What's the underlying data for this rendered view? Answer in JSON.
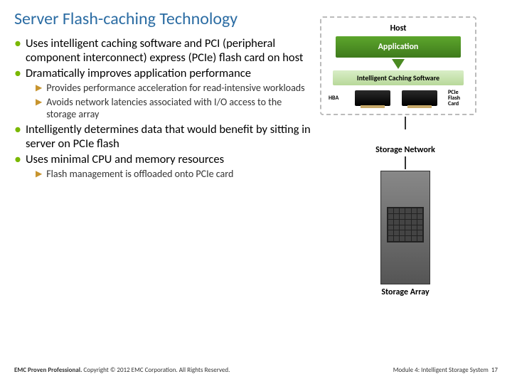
{
  "title": "Server Flash-caching Technology",
  "bullets": {
    "b1": "Uses intelligent caching software and PCI (peripheral component interconnect) express (PCIe) flash card on host",
    "b2": "Dramatically improves application performance",
    "s1": "Provides performance acceleration for read-intensive workloads",
    "s2": "Avoids network latencies associated with I/O access to the storage array",
    "b3": "Intelligently determines data that would benefit by sitting in server on PCIe flash",
    "b4": "Uses minimal CPU and memory resources",
    "s3": "Flash management is offloaded onto PCIe card"
  },
  "diagram": {
    "host": "Host",
    "application": "Application",
    "ics": "Intelligent Caching Software",
    "hba": "HBA",
    "pcie": "PCIe Flash Card",
    "storage_network": "Storage Network",
    "storage_array": "Storage Array"
  },
  "footer": {
    "left_bold": "EMC Proven Professional.",
    "left_rest": " Copyright © 2012 EMC Corporation. All Rights Reserved.",
    "right": "Module 4: Intelligent Storage System",
    "page": "17"
  }
}
